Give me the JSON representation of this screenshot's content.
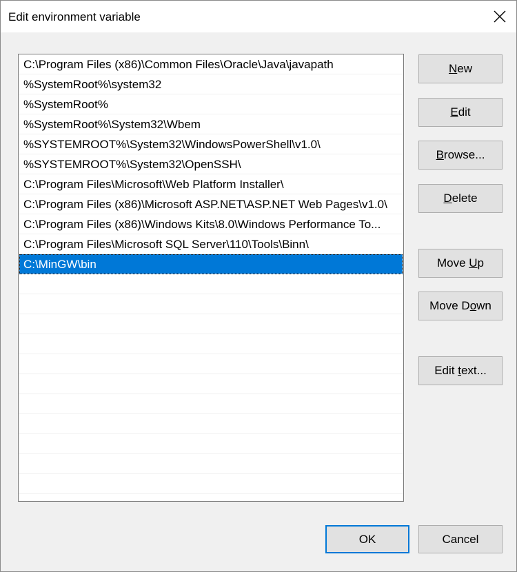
{
  "window": {
    "title": "Edit environment variable",
    "close_icon": "close-icon"
  },
  "list": {
    "items": [
      "C:\\Program Files (x86)\\Common Files\\Oracle\\Java\\javapath",
      "%SystemRoot%\\system32",
      "%SystemRoot%",
      "%SystemRoot%\\System32\\Wbem",
      "%SYSTEMROOT%\\System32\\WindowsPowerShell\\v1.0\\",
      "%SYSTEMROOT%\\System32\\OpenSSH\\",
      "C:\\Program Files\\Microsoft\\Web Platform Installer\\",
      "C:\\Program Files (x86)\\Microsoft ASP.NET\\ASP.NET Web Pages\\v1.0\\",
      "C:\\Program Files (x86)\\Windows Kits\\8.0\\Windows Performance To...",
      "C:\\Program Files\\Microsoft SQL Server\\110\\Tools\\Binn\\",
      "C:\\MinGW\\bin"
    ],
    "selected_index": 10
  },
  "buttons": {
    "new": {
      "pre": "",
      "accel": "N",
      "post": "ew"
    },
    "edit": {
      "pre": "",
      "accel": "E",
      "post": "dit"
    },
    "browse": {
      "pre": "",
      "accel": "B",
      "post": "rowse..."
    },
    "delete": {
      "pre": "",
      "accel": "D",
      "post": "elete"
    },
    "move_up": {
      "pre": "Move ",
      "accel": "U",
      "post": "p"
    },
    "move_down": {
      "pre": "Move D",
      "accel": "o",
      "post": "wn"
    },
    "edit_text": {
      "pre": "Edit ",
      "accel": "t",
      "post": "ext..."
    },
    "ok": "OK",
    "cancel": "Cancel"
  },
  "colors": {
    "selection": "#0078d7",
    "default_button_border": "#0078d7"
  }
}
